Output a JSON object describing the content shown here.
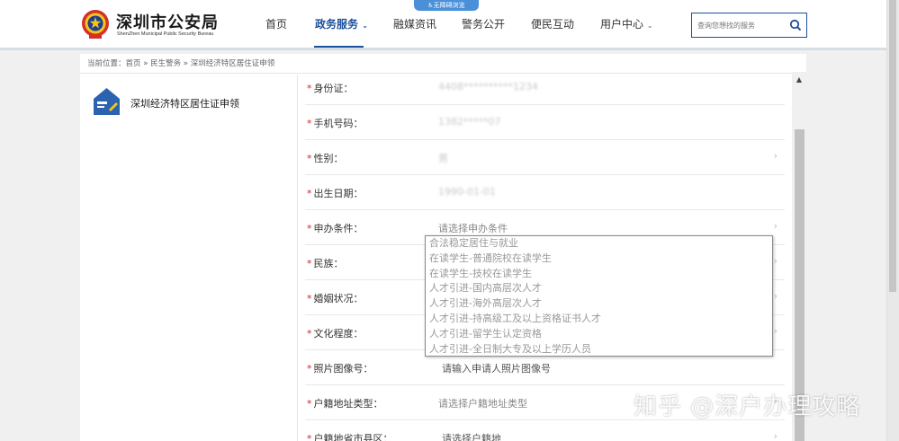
{
  "header": {
    "brand_title": "深圳市公安局",
    "brand_subtitle": "ShenZhen Municipal Public Security Bureau",
    "accessibility_badge": "无障碍浏览",
    "nav": [
      {
        "label": "首页"
      },
      {
        "label": "政务服务"
      },
      {
        "label": "融媒资讯"
      },
      {
        "label": "警务公开"
      },
      {
        "label": "便民互动"
      },
      {
        "label": "用户中心"
      }
    ],
    "search_placeholder": "查询您想找的服务"
  },
  "breadcrumb": "当前位置：首页 » 民生警务 » 深圳经济特区居住证申领",
  "sidebar": {
    "title": "深圳经济特区居住证申领"
  },
  "form": {
    "fields": [
      {
        "label": "身份证：",
        "value": "4408**********1234"
      },
      {
        "label": "手机号码：",
        "value": "1382*****07"
      },
      {
        "label": "性别：",
        "value": "男"
      },
      {
        "label": "出生日期：",
        "value": "1990-01-01"
      },
      {
        "label": "申办条件：",
        "value": "请选择申办条件"
      },
      {
        "label": "民族：",
        "value": ""
      },
      {
        "label": "婚姻状况：",
        "value": ""
      },
      {
        "label": "文化程度：",
        "value": ""
      },
      {
        "label": "照片图像号：",
        "value": "请输入申请人照片图像号"
      },
      {
        "label": "户籍地址类型：",
        "value": "请选择户籍地址类型"
      },
      {
        "label": "户籍地省市县区：",
        "value": "请选择户籍地"
      }
    ],
    "dropdown_options": [
      "合法稳定居住与就业",
      "在读学生-普通院校在读学生",
      "在读学生-技校在读学生",
      "人才引进-国内高层次人才",
      "人才引进-海外高层次人才",
      "人才引进-持高级工及以上资格证书人才",
      "人才引进-留学生认定资格",
      "人才引进-全日制大专及以上学历人员"
    ]
  },
  "watermark": "知乎 @深户办理攻略",
  "colors": {
    "brand_blue": "#1c4f9c",
    "required_red": "#e02020",
    "badge_blue": "#4a90d9"
  }
}
